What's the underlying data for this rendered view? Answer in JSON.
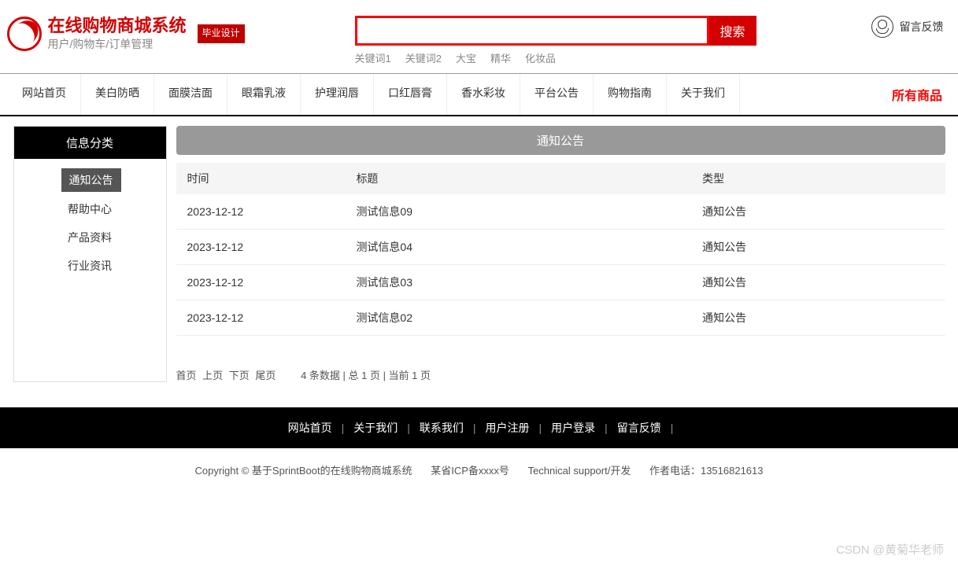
{
  "header": {
    "brand_title": "在线购物商城系统",
    "brand_sub": "用户/购物车/订单管理",
    "grad_badge": "毕业设计",
    "search_placeholder": "",
    "search_btn": "搜索",
    "keywords": [
      "关键词1",
      "关键词2",
      "大宝",
      "精华",
      "化妆品"
    ],
    "feedback": "留言反馈"
  },
  "nav": {
    "items": [
      "网站首页",
      "美白防晒",
      "面膜洁面",
      "眼霜乳液",
      "护理润唇",
      "口红唇膏",
      "香水彩妆",
      "平台公告",
      "购物指南",
      "关于我们"
    ],
    "all_products": "所有商品"
  },
  "sidebar": {
    "title": "信息分类",
    "categories": [
      {
        "label": "通知公告",
        "active": true
      },
      {
        "label": "帮助中心",
        "active": false
      },
      {
        "label": "产品资料",
        "active": false
      },
      {
        "label": "行业资讯",
        "active": false
      }
    ]
  },
  "content": {
    "title": "通知公告",
    "columns": {
      "time": "时间",
      "title": "标题",
      "type": "类型"
    },
    "rows": [
      {
        "time": "2023-12-12",
        "title": "测试信息09",
        "type": "通知公告"
      },
      {
        "time": "2023-12-12",
        "title": "测试信息04",
        "type": "通知公告"
      },
      {
        "time": "2023-12-12",
        "title": "测试信息03",
        "type": "通知公告"
      },
      {
        "time": "2023-12-12",
        "title": "测试信息02",
        "type": "通知公告"
      }
    ],
    "pager": {
      "first": "首页",
      "prev": "上页",
      "next": "下页",
      "last": "尾页",
      "info": "4 条数据 | 总 1 页 | 当前 1 页"
    }
  },
  "footer": {
    "links": [
      "网站首页",
      "关于我们",
      "联系我们",
      "用户注册",
      "用户登录",
      "留言反馈"
    ],
    "copyright": "Copyright © 基于SprintBoot的在线购物商城系统",
    "icp": "某省ICP备xxxx号",
    "tech": "Technical support/开发",
    "phone": "作者电话：13516821613"
  },
  "watermark": "CSDN @黄菊华老师"
}
